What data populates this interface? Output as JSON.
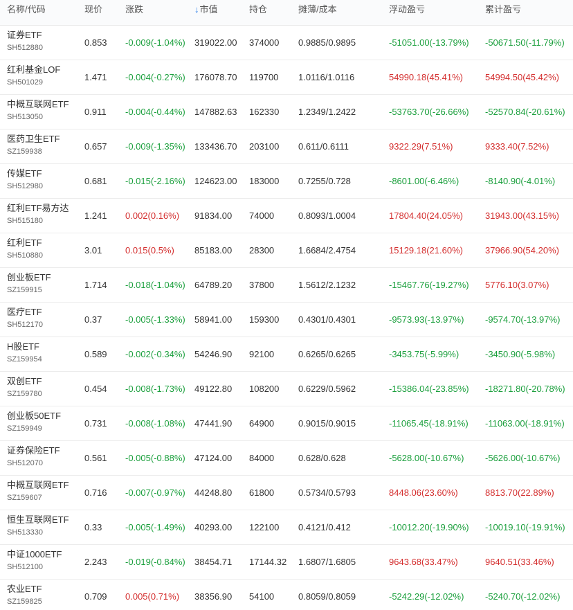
{
  "colors": {
    "up": "#d42e2e",
    "down": "#1a9f3c",
    "sort_accent": "#1a73e8"
  },
  "header": {
    "name": "名称/代码",
    "price": "现价",
    "change": "涨跌",
    "sort_icon": "arrow-down-icon",
    "sort_glyph": "↓",
    "market_value": "市值",
    "holding": "持仓",
    "cost": "摊薄/成本",
    "floating_pl": "浮动盈亏",
    "total_pl": "累计盈亏"
  },
  "rows": [
    {
      "name": "证券ETF",
      "code": "SH512880",
      "price": "0.853",
      "change": "-0.009(-1.04%)",
      "change_dir": "down",
      "market_value": "319022.00",
      "holding": "374000",
      "cost": "0.9885/0.9895",
      "floating_pl": "-51051.00(-13.79%)",
      "floating_dir": "down",
      "total_pl": "-50671.50(-11.79%)",
      "total_dir": "down"
    },
    {
      "name": "红利基金LOF",
      "code": "SH501029",
      "price": "1.471",
      "change": "-0.004(-0.27%)",
      "change_dir": "down",
      "market_value": "176078.70",
      "holding": "119700",
      "cost": "1.0116/1.0116",
      "floating_pl": "54990.18(45.41%)",
      "floating_dir": "up",
      "total_pl": "54994.50(45.42%)",
      "total_dir": "up"
    },
    {
      "name": "中概互联网ETF",
      "code": "SH513050",
      "price": "0.911",
      "change": "-0.004(-0.44%)",
      "change_dir": "down",
      "market_value": "147882.63",
      "holding": "162330",
      "cost": "1.2349/1.2422",
      "floating_pl": "-53763.70(-26.66%)",
      "floating_dir": "down",
      "total_pl": "-52570.84(-20.61%)",
      "total_dir": "down"
    },
    {
      "name": "医药卫生ETF",
      "code": "SZ159938",
      "price": "0.657",
      "change": "-0.009(-1.35%)",
      "change_dir": "down",
      "market_value": "133436.70",
      "holding": "203100",
      "cost": "0.611/0.6111",
      "floating_pl": "9322.29(7.51%)",
      "floating_dir": "up",
      "total_pl": "9333.40(7.52%)",
      "total_dir": "up"
    },
    {
      "name": "传媒ETF",
      "code": "SH512980",
      "price": "0.681",
      "change": "-0.015(-2.16%)",
      "change_dir": "down",
      "market_value": "124623.00",
      "holding": "183000",
      "cost": "0.7255/0.728",
      "floating_pl": "-8601.00(-6.46%)",
      "floating_dir": "down",
      "total_pl": "-8140.90(-4.01%)",
      "total_dir": "down"
    },
    {
      "name": "红利ETF易方达",
      "code": "SH515180",
      "price": "1.241",
      "change": "0.002(0.16%)",
      "change_dir": "up",
      "market_value": "91834.00",
      "holding": "74000",
      "cost": "0.8093/1.0004",
      "floating_pl": "17804.40(24.05%)",
      "floating_dir": "up",
      "total_pl": "31943.00(43.15%)",
      "total_dir": "up"
    },
    {
      "name": "红利ETF",
      "code": "SH510880",
      "price": "3.01",
      "change": "0.015(0.5%)",
      "change_dir": "up",
      "market_value": "85183.00",
      "holding": "28300",
      "cost": "1.6684/2.4754",
      "floating_pl": "15129.18(21.60%)",
      "floating_dir": "up",
      "total_pl": "37966.90(54.20%)",
      "total_dir": "up"
    },
    {
      "name": "创业板ETF",
      "code": "SZ159915",
      "price": "1.714",
      "change": "-0.018(-1.04%)",
      "change_dir": "down",
      "market_value": "64789.20",
      "holding": "37800",
      "cost": "1.5612/2.1232",
      "floating_pl": "-15467.76(-19.27%)",
      "floating_dir": "down",
      "total_pl": "5776.10(3.07%)",
      "total_dir": "up"
    },
    {
      "name": "医疗ETF",
      "code": "SH512170",
      "price": "0.37",
      "change": "-0.005(-1.33%)",
      "change_dir": "down",
      "market_value": "58941.00",
      "holding": "159300",
      "cost": "0.4301/0.4301",
      "floating_pl": "-9573.93(-13.97%)",
      "floating_dir": "down",
      "total_pl": "-9574.70(-13.97%)",
      "total_dir": "down"
    },
    {
      "name": "H股ETF",
      "code": "SZ159954",
      "price": "0.589",
      "change": "-0.002(-0.34%)",
      "change_dir": "down",
      "market_value": "54246.90",
      "holding": "92100",
      "cost": "0.6265/0.6265",
      "floating_pl": "-3453.75(-5.99%)",
      "floating_dir": "down",
      "total_pl": "-3450.90(-5.98%)",
      "total_dir": "down"
    },
    {
      "name": "双创ETF",
      "code": "SZ159780",
      "price": "0.454",
      "change": "-0.008(-1.73%)",
      "change_dir": "down",
      "market_value": "49122.80",
      "holding": "108200",
      "cost": "0.6229/0.5962",
      "floating_pl": "-15386.04(-23.85%)",
      "floating_dir": "down",
      "total_pl": "-18271.80(-20.78%)",
      "total_dir": "down"
    },
    {
      "name": "创业板50ETF",
      "code": "SZ159949",
      "price": "0.731",
      "change": "-0.008(-1.08%)",
      "change_dir": "down",
      "market_value": "47441.90",
      "holding": "64900",
      "cost": "0.9015/0.9015",
      "floating_pl": "-11065.45(-18.91%)",
      "floating_dir": "down",
      "total_pl": "-11063.00(-18.91%)",
      "total_dir": "down"
    },
    {
      "name": "证券保险ETF",
      "code": "SH512070",
      "price": "0.561",
      "change": "-0.005(-0.88%)",
      "change_dir": "down",
      "market_value": "47124.00",
      "holding": "84000",
      "cost": "0.628/0.628",
      "floating_pl": "-5628.00(-10.67%)",
      "floating_dir": "down",
      "total_pl": "-5626.00(-10.67%)",
      "total_dir": "down"
    },
    {
      "name": "中概互联网ETF",
      "code": "SZ159607",
      "price": "0.716",
      "change": "-0.007(-0.97%)",
      "change_dir": "down",
      "market_value": "44248.80",
      "holding": "61800",
      "cost": "0.5734/0.5793",
      "floating_pl": "8448.06(23.60%)",
      "floating_dir": "up",
      "total_pl": "8813.70(22.89%)",
      "total_dir": "up"
    },
    {
      "name": "恒生互联网ETF",
      "code": "SH513330",
      "price": "0.33",
      "change": "-0.005(-1.49%)",
      "change_dir": "down",
      "market_value": "40293.00",
      "holding": "122100",
      "cost": "0.4121/0.412",
      "floating_pl": "-10012.20(-19.90%)",
      "floating_dir": "down",
      "total_pl": "-10019.10(-19.91%)",
      "total_dir": "down"
    },
    {
      "name": "中证1000ETF",
      "code": "SH512100",
      "price": "2.243",
      "change": "-0.019(-0.84%)",
      "change_dir": "down",
      "market_value": "38454.71",
      "holding": "17144.32",
      "cost": "1.6807/1.6805",
      "floating_pl": "9643.68(33.47%)",
      "floating_dir": "up",
      "total_pl": "9640.51(33.46%)",
      "total_dir": "up"
    },
    {
      "name": "农业ETF",
      "code": "SZ159825",
      "price": "0.709",
      "change": "0.005(0.71%)",
      "change_dir": "up",
      "market_value": "38356.90",
      "holding": "54100",
      "cost": "0.8059/0.8059",
      "floating_pl": "-5242.29(-12.02%)",
      "floating_dir": "down",
      "total_pl": "-5240.70(-12.02%)",
      "total_dir": "down"
    }
  ]
}
